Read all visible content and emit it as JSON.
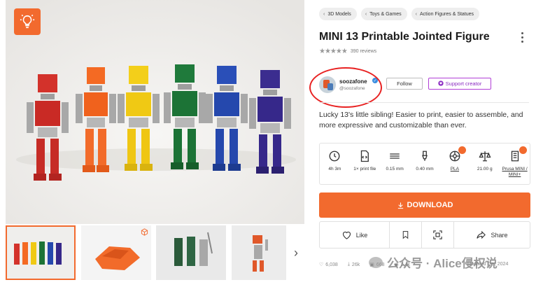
{
  "breadcrumbs": [
    "3D Models",
    "Toys & Games",
    "Action Figures & Statues"
  ],
  "title": "MINI 13 Printable Jointed Figure",
  "rating": {
    "stars": 5,
    "reviews": "390 reviews"
  },
  "creator": {
    "name": "soozafone",
    "handle": "@soozafone"
  },
  "buttons": {
    "follow": "Follow",
    "support": "Support creator",
    "download": "DOWNLOAD"
  },
  "description": "Lucky 13's little sibling! Easier to print, easier to assemble, and more expressive and customizable than ever.",
  "specs": [
    {
      "icon": "clock-icon",
      "value": "4h 3m"
    },
    {
      "icon": "file-code-icon",
      "value": "1× print file"
    },
    {
      "icon": "layer-height-icon",
      "value": "0.15 mm"
    },
    {
      "icon": "nozzle-icon",
      "value": "0.40 mm"
    },
    {
      "icon": "filament-spool-icon",
      "value": "PLA"
    },
    {
      "icon": "weight-scale-icon",
      "value": "21.00 g"
    },
    {
      "icon": "printer-icon",
      "value": "Prusa MINI / MINI+"
    }
  ],
  "actions": {
    "like": "Like",
    "share": "Share"
  },
  "stats": {
    "likes": "6,038",
    "downloads": "26k",
    "makes": "668",
    "views": "1.4k"
  },
  "updated": "Updated Dec 2024",
  "watermark": "公众号 · Alice侵权说",
  "colors": {
    "accent": "#f26a2e",
    "support": "#8b2cc2",
    "highlight_ring": "#e82222"
  }
}
